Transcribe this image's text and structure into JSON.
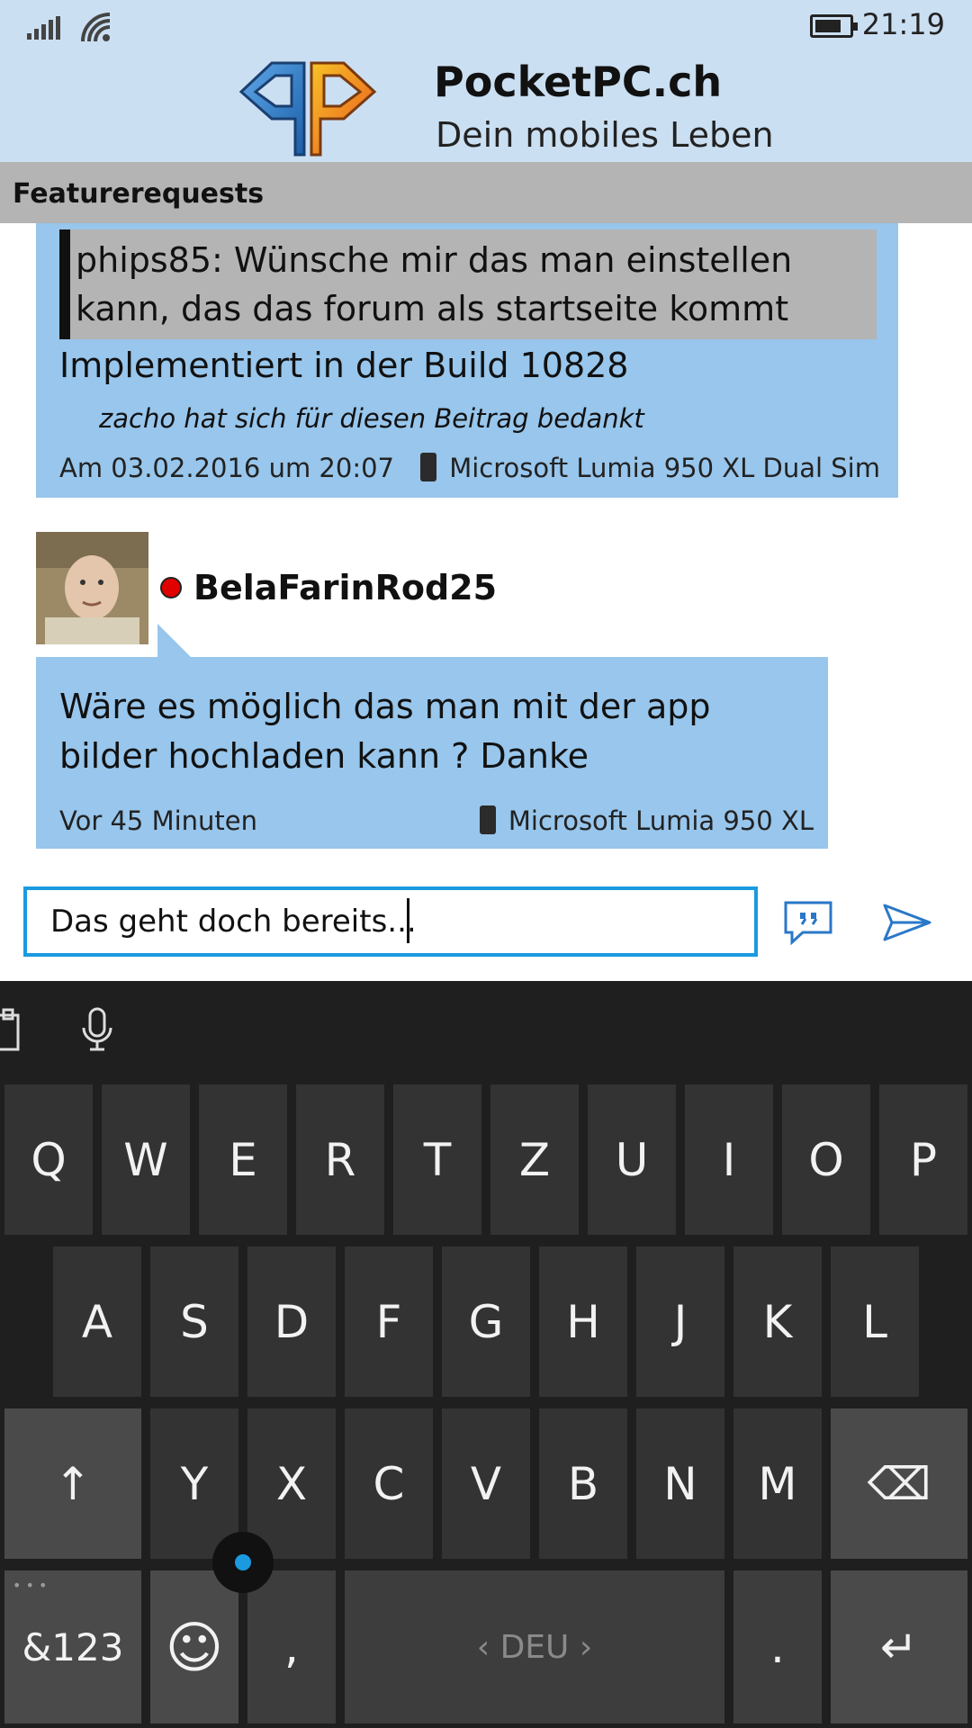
{
  "status_bar": {
    "time": "21:19"
  },
  "header": {
    "brand_title": "PocketPC.ch",
    "brand_subtitle": "Dein mobiles Leben"
  },
  "section": {
    "title": "Featurerequests"
  },
  "posts": [
    {
      "quote": "phips85: Wünsche mir das man einstellen kann, das das forum als startseite kommt",
      "text": "Implementiert in der Build 10828",
      "thanks": "zacho hat sich für diesen Beitrag bedankt",
      "date": "Am 03.02.2016 um 20:07",
      "device": "Microsoft Lumia 950 XL Dual Sim"
    },
    {
      "username": "BelaFarinRod25",
      "online": true,
      "text": "Wäre es möglich das man mit der app bilder hochladen kann ? Danke",
      "time": "Vor 45 Minuten",
      "device": "Microsoft Lumia 950 XL"
    }
  ],
  "reply": {
    "value": "Das geht doch bereits..."
  },
  "keyboard": {
    "row1": [
      "Q",
      "W",
      "E",
      "R",
      "T",
      "Z",
      "U",
      "I",
      "O",
      "P"
    ],
    "row2": [
      "A",
      "S",
      "D",
      "F",
      "G",
      "H",
      "J",
      "K",
      "L"
    ],
    "row3": [
      "Y",
      "X",
      "C",
      "V",
      "B",
      "N",
      "M"
    ],
    "shift": "↑",
    "backspace": "⌫",
    "symbols": "&123",
    "emoji": "☺",
    "comma": ",",
    "space": "‹ DEU ›",
    "period": ".",
    "enter": "↵",
    "more": "• • •"
  },
  "colors": {
    "header_bg": "#cbdff2",
    "post_bg": "#98c6ec",
    "accent": "#1b9ae0",
    "keyboard_bg": "#1f1f1f"
  },
  "icons": [
    "signal-icon",
    "wifi-icon",
    "battery-icon",
    "pocketpc-logo",
    "phone-icon",
    "quote-icon",
    "send-icon",
    "clipboard-icon",
    "microphone-icon"
  ]
}
